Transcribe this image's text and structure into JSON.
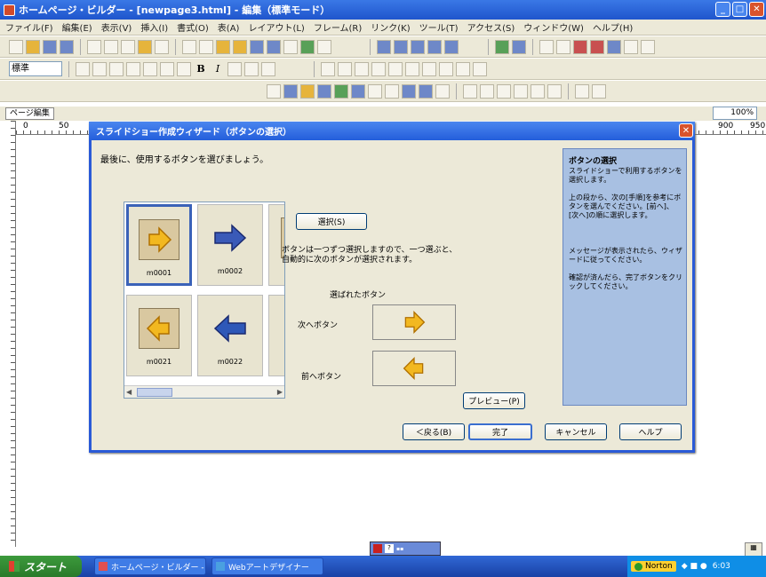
{
  "window": {
    "title": "ホームページ・ビルダー - [newpage3.html] - 編集（標準モード）",
    "min_icon": "minimize-icon",
    "max_icon": "maximize-icon",
    "close_icon": "close-icon"
  },
  "menubar": {
    "items": [
      "ファイル(F)",
      "編集(E)",
      "表示(V)",
      "挿入(I)",
      "書式(O)",
      "表(A)",
      "レイアウト(L)",
      "フレーム(R)",
      "リンク(K)",
      "ツール(T)",
      "アクセス(S)",
      "ウィンドウ(W)",
      "ヘルプ(H)"
    ]
  },
  "format_toolbar": {
    "font_select": "標準",
    "bold": "B",
    "italic": "I"
  },
  "page_tabs": {
    "edit_tab": "ページ編集"
  },
  "zoom": {
    "value": "100%"
  },
  "ruler": {
    "marks": [
      "0",
      "50",
      "900",
      "950"
    ]
  },
  "dialog": {
    "title": "スライドショー作成ウィザード（ボタンの選択）",
    "instruction": "最後に、使用するボタンを選びましょう。",
    "select_button": "選択(S)",
    "note": "ボタンは一つずつ選択しますので、一つ選ぶと、自動的に次のボタンが選択されます。",
    "selected_label": "選ばれたボタン",
    "next_label": "次へボタン",
    "prev_label": "前へボタン",
    "preview_button": "プレビュー(P)",
    "back_button": "＜戻る(B)",
    "finish_button": "完了",
    "cancel_button": "キャンセル",
    "help_button": "ヘルプ",
    "gallery": {
      "items": [
        {
          "name": "m0001",
          "arrow": "right",
          "color": "#f2b820",
          "framed": true,
          "selected": true
        },
        {
          "name": "m0002",
          "arrow": "right",
          "color": "#3a5ab8",
          "framed": false,
          "selected": false
        },
        {
          "name": "m0021",
          "arrow": "left",
          "color": "#f2b820",
          "framed": true,
          "selected": false
        },
        {
          "name": "m0022",
          "arrow": "left",
          "color": "#2e58b8",
          "framed": false,
          "selected": false
        }
      ]
    },
    "sidebar": {
      "heading": "ボタンの選択",
      "paragraphs": [
        "スライドショーで利用するボタンを選択します。",
        "上の段から、次の[手順]を参考にボタンを選んでください。[前へ]、[次へ]の順に選択します。",
        "メッセージが表示されたら、ウィザードに従ってください。",
        "確認が済んだら、完了ボタンをクリックしてください。"
      ]
    }
  },
  "taskbar": {
    "start_label": "スタート",
    "tasks": [
      "ホームページ・ビルダー - ...",
      "Webアートデザイナー"
    ],
    "norton": "Norton",
    "clock": "6:03"
  }
}
